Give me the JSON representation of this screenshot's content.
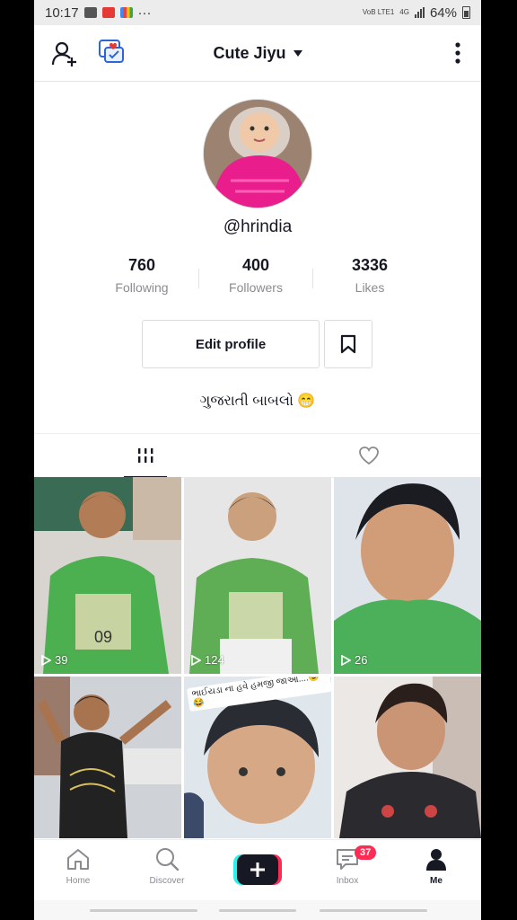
{
  "status": {
    "time": "10:17",
    "dots": "···",
    "net": "VoB LTE1",
    "net2": "4G",
    "battery": "64%"
  },
  "header": {
    "username_title": "Cute Jiyu"
  },
  "profile": {
    "handle": "@hrindia",
    "stats": [
      {
        "value": "760",
        "label": "Following"
      },
      {
        "value": "400",
        "label": "Followers"
      },
      {
        "value": "3336",
        "label": "Likes"
      }
    ],
    "edit_label": "Edit profile",
    "bio": "ગુજરાતી બાબલો 😁"
  },
  "videos": [
    {
      "views": "39"
    },
    {
      "views": "124"
    },
    {
      "views": "26"
    },
    {
      "views": ""
    },
    {
      "views": "",
      "caption": "ભાઈયડા ના હવે હમજી જાઓ....😉😂"
    },
    {
      "views": ""
    }
  ],
  "nav": {
    "home": "Home",
    "discover": "Discover",
    "inbox": "Inbox",
    "inbox_badge": "37",
    "me": "Me"
  },
  "colors": {
    "accent": "#fe2c55",
    "cyan": "#25f4ee",
    "shirt": "#4caf50"
  },
  "icons": [
    "add-user-icon",
    "chat-heart-icon",
    "caret-down-icon",
    "more-vertical-icon",
    "bookmark-icon",
    "grid-icon",
    "heart-icon",
    "play-icon",
    "home-icon",
    "discover-icon",
    "plus-icon",
    "inbox-icon",
    "me-icon"
  ]
}
